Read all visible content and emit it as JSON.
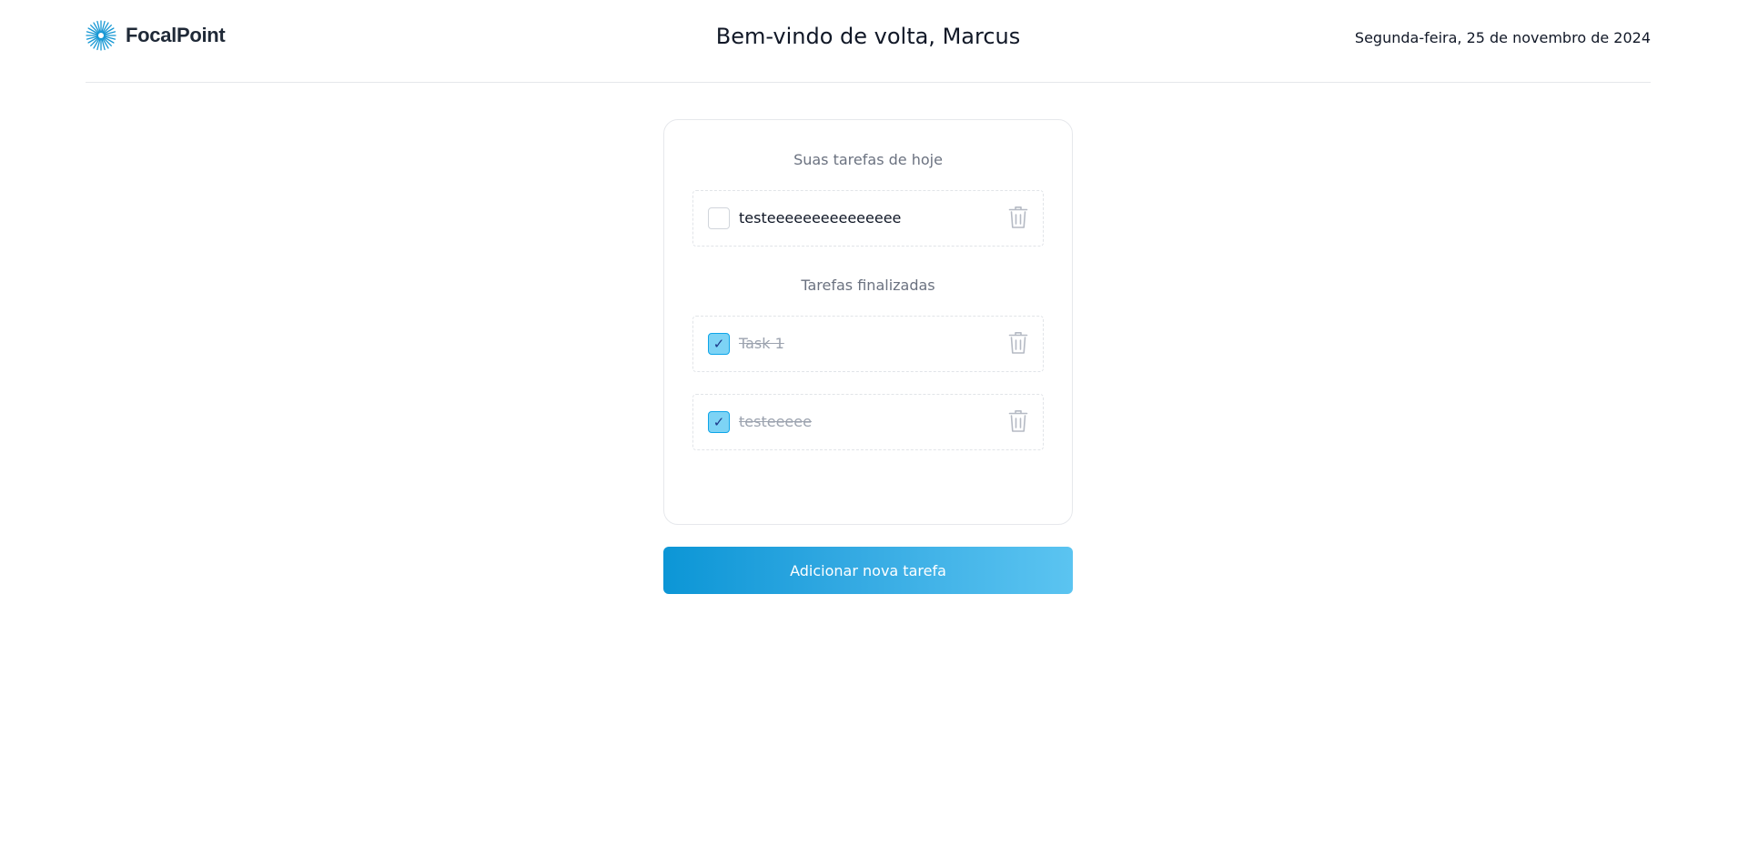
{
  "header": {
    "brand_name": "FocalPoint",
    "welcome": "Bem-vindo de volta, Marcus",
    "date": "Segunda-feira, 25 de novembro de 2024"
  },
  "today": {
    "title": "Suas tarefas de hoje",
    "tasks": [
      {
        "label": "testeeeeeeeeeeeeeee",
        "done": false
      }
    ]
  },
  "finished": {
    "title": "Tarefas finalizadas",
    "tasks": [
      {
        "label": "Task 1",
        "done": true
      },
      {
        "label": "testeeeee",
        "done": true
      }
    ]
  },
  "actions": {
    "add_label": "Adicionar nova tarefa"
  },
  "icons": {
    "logo": "sunburst-logo-icon",
    "delete": "trash-icon",
    "check": "check-icon"
  },
  "colors": {
    "brand_blue": "#0c96d6",
    "checked_fill": "#7dd3f5",
    "button_gradient_end": "#5bc4f1"
  }
}
